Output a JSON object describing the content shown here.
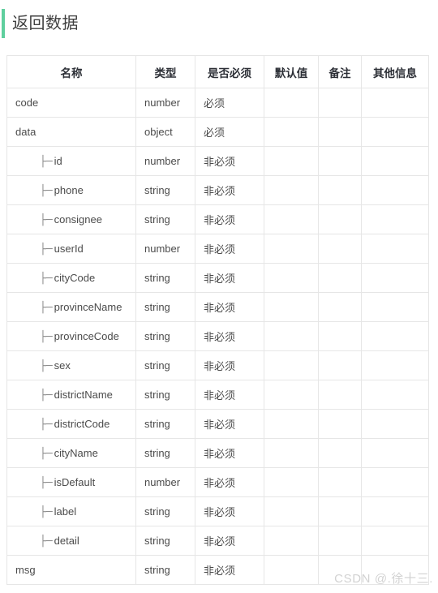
{
  "section": {
    "title": "返回数据",
    "accent_color": "#5fcf9e"
  },
  "table": {
    "columns": [
      {
        "key": "name",
        "label": "名称"
      },
      {
        "key": "type",
        "label": "类型"
      },
      {
        "key": "required",
        "label": "是否必须"
      },
      {
        "key": "default",
        "label": "默认值"
      },
      {
        "key": "note",
        "label": "备注"
      },
      {
        "key": "other",
        "label": "其他信息"
      }
    ],
    "tree_branch": "├─",
    "rows": [
      {
        "indent": 0,
        "name": "code",
        "type": "number",
        "required": "必须",
        "default": "",
        "note": "",
        "other": ""
      },
      {
        "indent": 0,
        "name": "data",
        "type": "object",
        "required": "必须",
        "default": "",
        "note": "",
        "other": ""
      },
      {
        "indent": 1,
        "name": "id",
        "type": "number",
        "required": "非必须",
        "default": "",
        "note": "",
        "other": ""
      },
      {
        "indent": 1,
        "name": "phone",
        "type": "string",
        "required": "非必须",
        "default": "",
        "note": "",
        "other": ""
      },
      {
        "indent": 1,
        "name": "consignee",
        "type": "string",
        "required": "非必须",
        "default": "",
        "note": "",
        "other": ""
      },
      {
        "indent": 1,
        "name": "userId",
        "type": "number",
        "required": "非必须",
        "default": "",
        "note": "",
        "other": ""
      },
      {
        "indent": 1,
        "name": "cityCode",
        "type": "string",
        "required": "非必须",
        "default": "",
        "note": "",
        "other": ""
      },
      {
        "indent": 1,
        "name": "provinceName",
        "type": "string",
        "required": "非必须",
        "default": "",
        "note": "",
        "other": ""
      },
      {
        "indent": 1,
        "name": "provinceCode",
        "type": "string",
        "required": "非必须",
        "default": "",
        "note": "",
        "other": ""
      },
      {
        "indent": 1,
        "name": "sex",
        "type": "string",
        "required": "非必须",
        "default": "",
        "note": "",
        "other": ""
      },
      {
        "indent": 1,
        "name": "districtName",
        "type": "string",
        "required": "非必须",
        "default": "",
        "note": "",
        "other": ""
      },
      {
        "indent": 1,
        "name": "districtCode",
        "type": "string",
        "required": "非必须",
        "default": "",
        "note": "",
        "other": ""
      },
      {
        "indent": 1,
        "name": "cityName",
        "type": "string",
        "required": "非必须",
        "default": "",
        "note": "",
        "other": ""
      },
      {
        "indent": 1,
        "name": "isDefault",
        "type": "number",
        "required": "非必须",
        "default": "",
        "note": "",
        "other": ""
      },
      {
        "indent": 1,
        "name": "label",
        "type": "string",
        "required": "非必须",
        "default": "",
        "note": "",
        "other": ""
      },
      {
        "indent": 1,
        "name": "detail",
        "type": "string",
        "required": "非必须",
        "default": "",
        "note": "",
        "other": ""
      },
      {
        "indent": 0,
        "name": "msg",
        "type": "string",
        "required": "非必须",
        "default": "",
        "note": "",
        "other": ""
      }
    ]
  },
  "watermark": {
    "text": "CSDN @.徐十三."
  }
}
